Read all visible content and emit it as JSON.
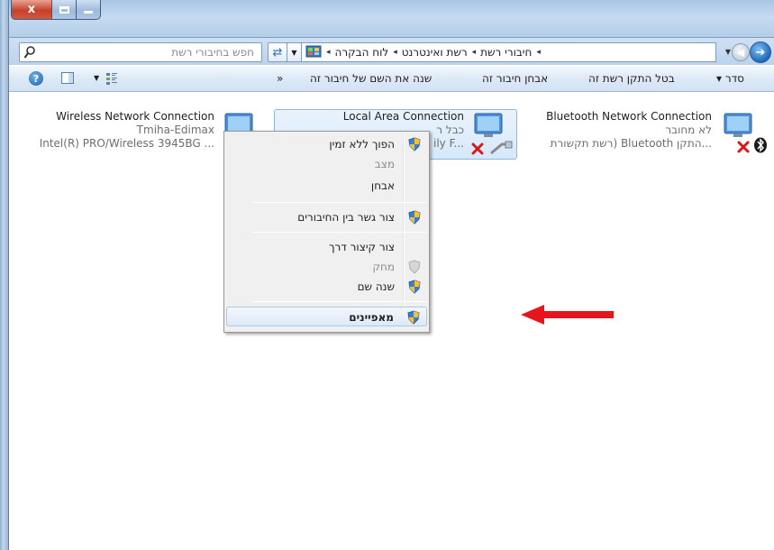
{
  "window": {
    "close_glyph": "x"
  },
  "search": {
    "placeholder": "חפש בחיבורי רשת"
  },
  "address": {
    "breadcrumbs": [
      "לוח הבקרה",
      "רשת ואינטרנט",
      "חיבורי רשת"
    ],
    "separator": "◂"
  },
  "toolbar": {
    "organize": "סדר ▾",
    "disable": "בטל התקן רשת זה",
    "diagnose": "אבחן חיבור זה",
    "rename": "שנה את השם של חיבור זה",
    "more": "«"
  },
  "connections": [
    {
      "name": "Bluetooth Network Connection",
      "status": "לא מחובר",
      "device": "רשת תקשורת) Bluetooth התקן..."
    },
    {
      "name": "Local Area Connection",
      "status": "כבל ר",
      "device": "ily F..."
    },
    {
      "name": "Wireless Network Connection",
      "status": "Tmiha-Edimax",
      "device": "Intel(R) PRO/Wireless 3945BG ..."
    }
  ],
  "context_menu": {
    "items": [
      {
        "label": "הפוך ללא זמין",
        "shield": true,
        "disabled": false
      },
      {
        "label": "מצב",
        "shield": false,
        "disabled": true
      },
      {
        "label": "אבחן",
        "shield": false,
        "disabled": false
      },
      {
        "label": "צור גשר בין החיבורים",
        "shield": true,
        "disabled": false
      },
      {
        "label": "צור קיצור דרך",
        "shield": false,
        "disabled": false
      },
      {
        "label": "מחק",
        "shield": true,
        "disabled": true
      },
      {
        "label": "שנה שם",
        "shield": true,
        "disabled": false
      },
      {
        "label": "מאפיינים",
        "shield": true,
        "disabled": false,
        "bold": true
      }
    ]
  },
  "colors": {
    "arrow": "#e8161c",
    "selection": "#d6e8fa"
  }
}
